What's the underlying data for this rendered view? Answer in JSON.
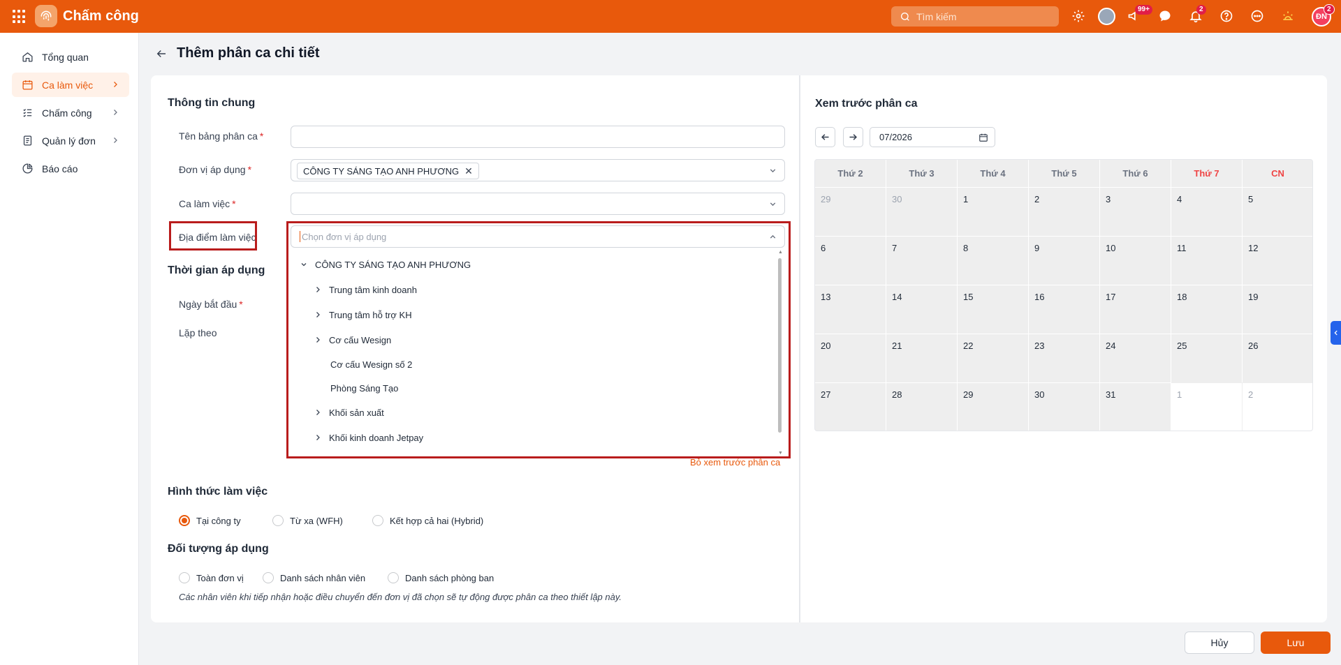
{
  "app": {
    "name": "Chấm công"
  },
  "search": {
    "placeholder": "Tìm kiếm"
  },
  "topbar": {
    "badge_megaphone": "99+",
    "badge_bell": "2",
    "avatar_initials": "ĐN",
    "avatar_badge": "2"
  },
  "sidebar": {
    "items": [
      {
        "label": "Tổng quan",
        "icon": "home-icon",
        "active": false
      },
      {
        "label": "Ca làm việc",
        "icon": "calendar-icon",
        "active": true
      },
      {
        "label": "Chấm công",
        "icon": "checklist-icon",
        "active": false
      },
      {
        "label": "Quản lý đơn",
        "icon": "document-icon",
        "active": false
      },
      {
        "label": "Báo cáo",
        "icon": "pie-chart-icon",
        "active": false
      }
    ]
  },
  "page": {
    "title": "Thêm phân ca chi tiết"
  },
  "general": {
    "title": "Thông tin chung",
    "name_label": "Tên bảng phân ca",
    "unit_label": "Đơn vị áp dụng",
    "unit_tag": "CÔNG TY SÁNG TẠO ANH PHƯƠNG",
    "shift_label": "Ca làm việc",
    "location_label": "Địa điểm làm việc",
    "location_placeholder": "Chọn đơn vị áp dụng"
  },
  "tree": {
    "root": "CÔNG TY SÁNG TẠO ANH PHƯƠNG",
    "children": [
      {
        "label": "Trung tâm kinh doanh",
        "expandable": true
      },
      {
        "label": "Trung tâm hỗ trợ KH",
        "expandable": true
      },
      {
        "label": "Cơ cấu Wesign",
        "expandable": true
      },
      {
        "label": "Cơ cấu Wesign số 2",
        "expandable": false
      },
      {
        "label": "Phòng Sáng Tạo",
        "expandable": false
      },
      {
        "label": "Khối sản xuất",
        "expandable": true
      },
      {
        "label": "Khối kinh doanh Jetpay",
        "expandable": true
      }
    ]
  },
  "time": {
    "title": "Thời gian áp dụng",
    "start_label": "Ngày bắt đầu",
    "repeat_label": "Lặp theo"
  },
  "preview_link": "Bỏ xem trước phân ca",
  "work_form": {
    "title": "Hình thức làm việc",
    "options": [
      "Tại công ty",
      "Từ xa (WFH)",
      "Kết hợp cả hai (Hybrid)"
    ],
    "selected": "Tại công ty"
  },
  "target": {
    "title": "Đối tượng áp dụng",
    "options": [
      "Toàn đơn vị",
      "Danh sách nhân viên",
      "Danh sách phòng ban"
    ],
    "hint": "Các nhân viên khi tiếp nhận hoặc điều chuyển đến đơn vị đã chọn sẽ tự động được phân ca theo thiết lập này."
  },
  "preview": {
    "title": "Xem trước phân ca",
    "month": "07/2026",
    "weekdays": [
      "Thứ 2",
      "Thứ 3",
      "Thứ 4",
      "Thứ 5",
      "Thứ 6",
      "Thứ 7",
      "CN"
    ],
    "weeks": [
      [
        "29",
        "30",
        "1",
        "2",
        "3",
        "4",
        "5"
      ],
      [
        "6",
        "7",
        "8",
        "9",
        "10",
        "11",
        "12"
      ],
      [
        "13",
        "14",
        "15",
        "16",
        "17",
        "18",
        "19"
      ],
      [
        "20",
        "21",
        "22",
        "23",
        "24",
        "25",
        "26"
      ],
      [
        "27",
        "28",
        "29",
        "30",
        "31",
        "1",
        "2"
      ]
    ]
  },
  "actions": {
    "cancel": "Hủy",
    "save": "Lưu"
  },
  "colors": {
    "brand": "#e8590c",
    "highlight": "#b91c1c",
    "weekend": "#ef4444"
  }
}
